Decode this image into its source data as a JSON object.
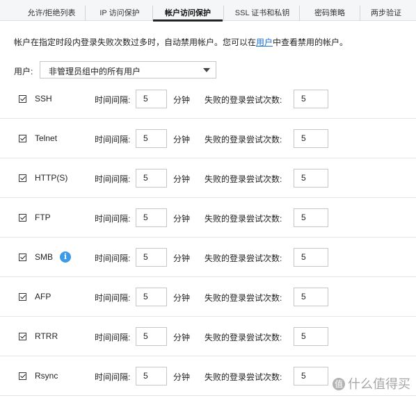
{
  "tabs": [
    {
      "label": "允许/拒绝列表",
      "active": false
    },
    {
      "label": "IP 访问保护",
      "active": false
    },
    {
      "label": "帐户访问保护",
      "active": true
    },
    {
      "label": "SSL 证书和私钥",
      "active": false
    },
    {
      "label": "密码策略",
      "active": false
    },
    {
      "label": "两步验证",
      "active": false
    }
  ],
  "description": {
    "before": "帐户在指定时段内登录失败次数过多时，自动禁用帐户。您可以在",
    "link": "用户",
    "after": "中查看禁用的帐户。"
  },
  "user_select": {
    "label": "用户:",
    "value": "非管理员组中的所有用户"
  },
  "field_labels": {
    "interval": "时间间隔:",
    "minutes": "分钟",
    "fail_attempts": "失败的登录尝试次数:"
  },
  "rows": [
    {
      "name": "SSH",
      "checked": true,
      "interval": "5",
      "attempts": "5"
    },
    {
      "name": "Telnet",
      "checked": true,
      "interval": "5",
      "attempts": "5"
    },
    {
      "name": "HTTP(S)",
      "checked": true,
      "interval": "5",
      "attempts": "5"
    },
    {
      "name": "FTP",
      "checked": true,
      "interval": "5",
      "attempts": "5"
    },
    {
      "name": "SMB",
      "checked": true,
      "interval": "5",
      "attempts": "5",
      "info": "i"
    },
    {
      "name": "AFP",
      "checked": true,
      "interval": "5",
      "attempts": "5"
    },
    {
      "name": "RTRR",
      "checked": true,
      "interval": "5",
      "attempts": "5"
    },
    {
      "name": "Rsync",
      "checked": true,
      "interval": "5",
      "attempts": "5"
    }
  ],
  "watermark": {
    "badge": "值",
    "text": "什么值得买"
  },
  "colors": {
    "link": "#1a6fd1",
    "info_icon": "#3d9ae8",
    "active_tab_underline": "#222222"
  }
}
